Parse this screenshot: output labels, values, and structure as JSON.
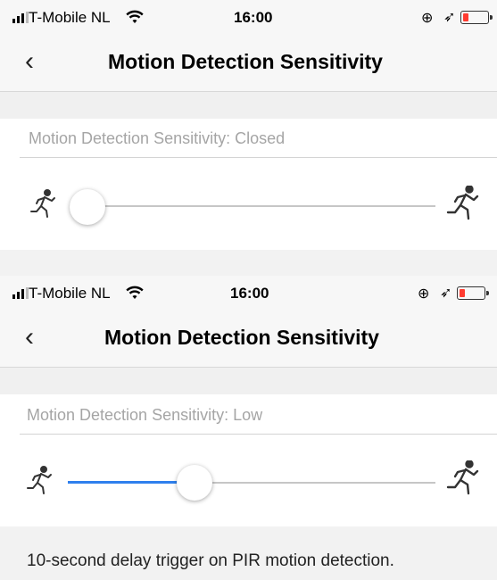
{
  "screens": [
    {
      "status_bar": {
        "carrier": "T-Mobile NL",
        "time": "16:00"
      },
      "nav": {
        "title": "Motion Detection Sensitivity"
      },
      "sensitivity_label": "Motion Detection Sensitivity: Closed",
      "slider": {
        "level": 0.0,
        "min_icon": "walking-person-icon",
        "max_icon": "running-person-icon"
      }
    },
    {
      "status_bar": {
        "carrier": "T-Mobile NL",
        "time": "16:00"
      },
      "nav": {
        "title": "Motion Detection Sensitivity"
      },
      "sensitivity_label": "Motion Detection Sensitivity: Low",
      "slider": {
        "level": 0.33,
        "min_icon": "walking-person-icon",
        "max_icon": "running-person-icon"
      },
      "description": "10-second delay trigger on PIR motion detection."
    }
  ],
  "colors": {
    "slider_fill": "#2f80ed",
    "battery_low": "#ff3b30"
  }
}
